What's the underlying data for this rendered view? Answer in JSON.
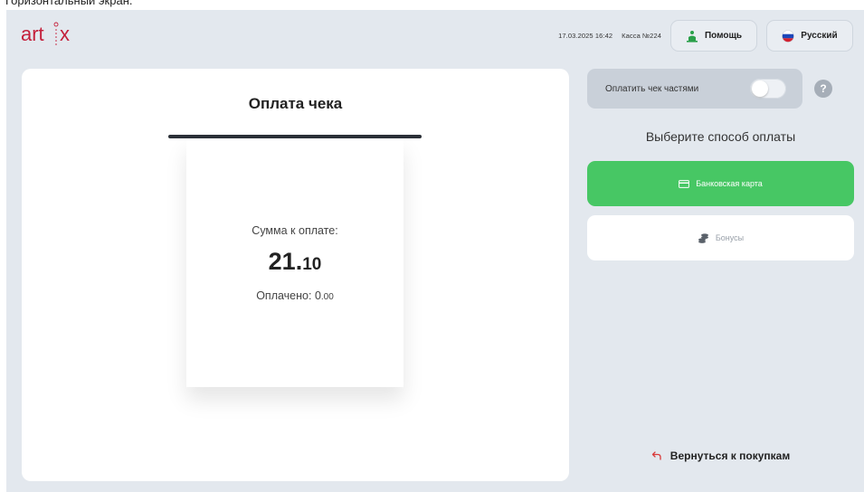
{
  "caption": "Горизонтальный экран.",
  "header": {
    "datetime": "17.03.2025 16:42",
    "register": "Касса №224",
    "help_label": "Помощь",
    "language_label": "Русский"
  },
  "receipt": {
    "title": "Оплата чека",
    "sum_label": "Сумма к оплате:",
    "sum_integer": "21",
    "sum_dot": ".",
    "sum_fraction": "10",
    "paid_label": "Оплачено: ",
    "paid_integer": "0",
    "paid_fraction": ".00"
  },
  "panel": {
    "split_label": "Оплатить чек частями",
    "split_enabled": false,
    "help_mark": "?",
    "choose_title": "Выберите способ оплаты",
    "methods": [
      {
        "label": "Банковская карта",
        "icon": "bank-card-icon",
        "color": "#47c764"
      },
      {
        "label": "Бонусы",
        "icon": "coins-icon"
      }
    ],
    "back_label": "Вернуться к покупкам"
  },
  "colors": {
    "accent_green": "#47c764",
    "brand_red": "#c4203b",
    "background": "#e3e8ee"
  }
}
